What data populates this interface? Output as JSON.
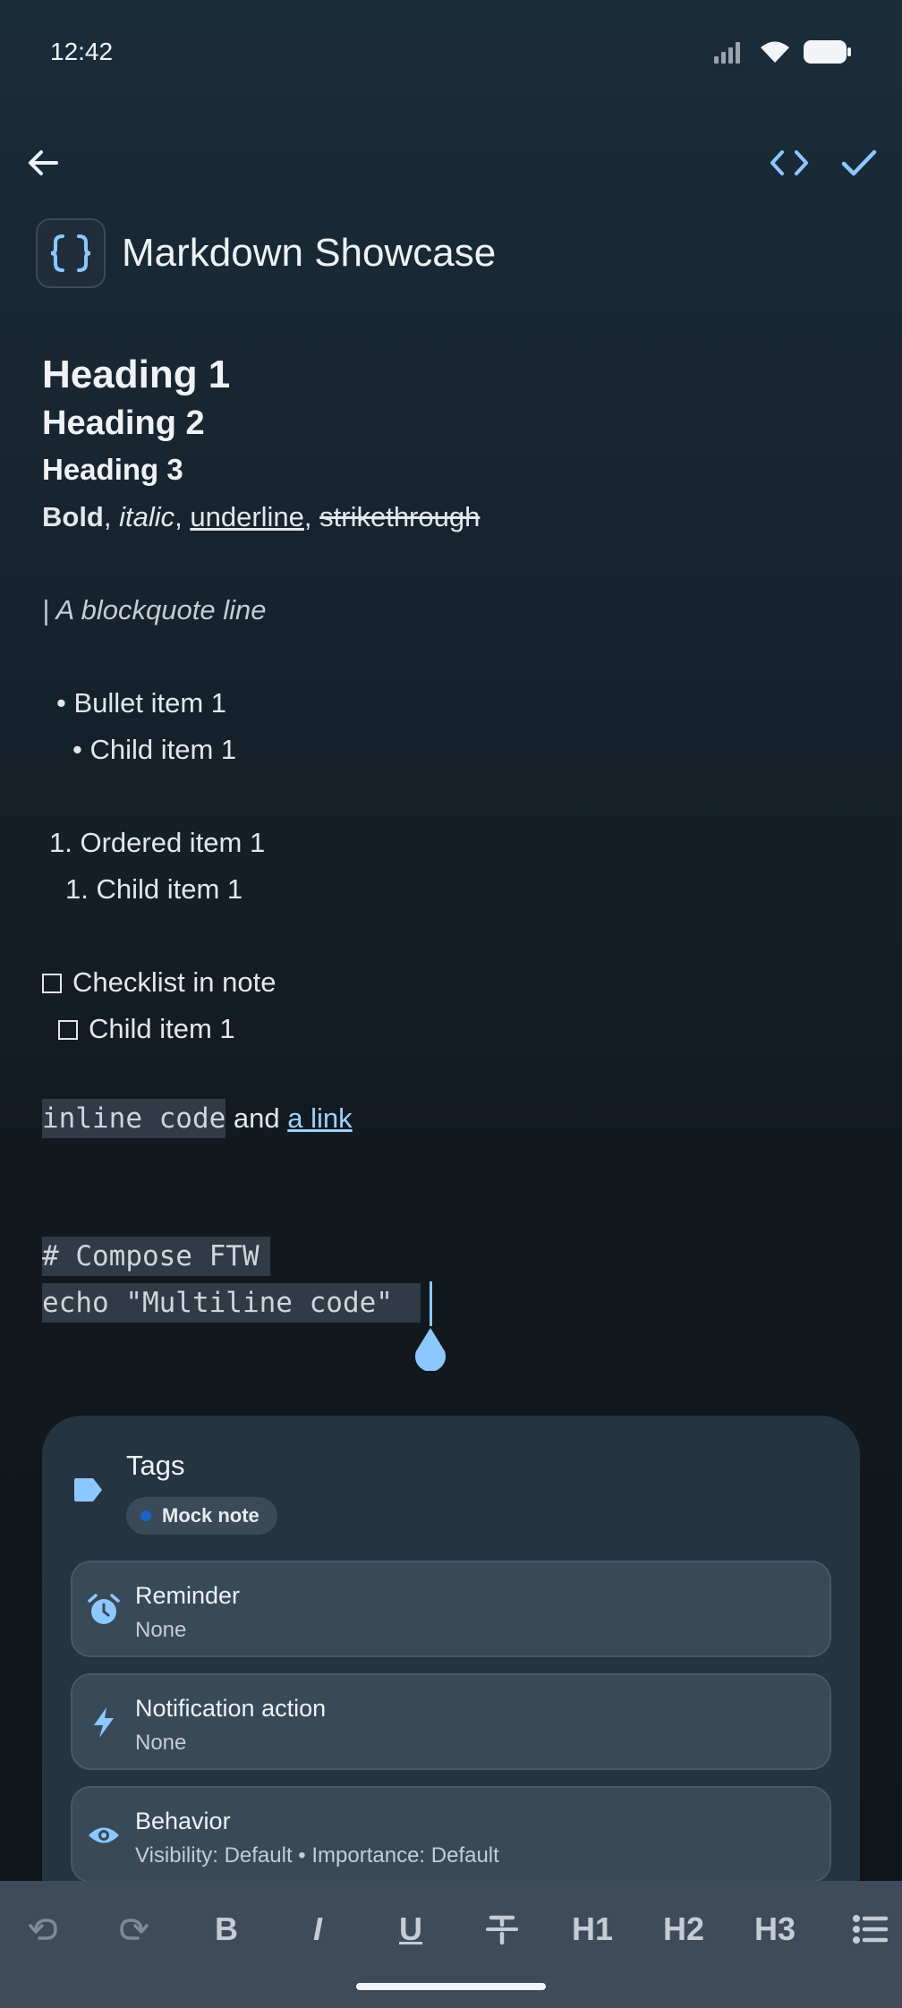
{
  "status_bar": {
    "time": "12:42"
  },
  "note": {
    "title": "Markdown Showcase",
    "heading1": "Heading 1",
    "heading2": "Heading 2",
    "heading3": "Heading 3",
    "inline_bold": "Bold",
    "inline_italic": "italic",
    "inline_underline": "underline",
    "inline_strike": "strikethrough",
    "blockquote": "| A blockquote line",
    "bullet_item": "• Bullet item 1",
    "bullet_child": "• Child item 1",
    "ordered_item": "1. Ordered item 1",
    "ordered_child": "1. Child item 1",
    "checklist_item": "Checklist in note",
    "checklist_child": "Child item 1",
    "inline_code": "inline code",
    "and_text": " and ",
    "link_text": "a link",
    "code_line1": "# Compose FTW",
    "code_line2": "echo \"Multiline code\" "
  },
  "sheet": {
    "tags_title": "Tags",
    "tag_chip": "Mock note",
    "reminder": {
      "title": "Reminder",
      "value": "None"
    },
    "notification": {
      "title": "Notification action",
      "value": "None"
    },
    "behavior": {
      "title": "Behavior",
      "value": "Visibility: Default • Importance: Default"
    }
  },
  "toolbar": {
    "bold": "B",
    "italic": "I",
    "underline": "U",
    "h1": "H1",
    "h2": "H2",
    "h3": "H3"
  },
  "colors": {
    "accent": "#8cc8ff",
    "chip_dot": "#1c63c8",
    "toolbar_bg": "#3d4b5a"
  }
}
